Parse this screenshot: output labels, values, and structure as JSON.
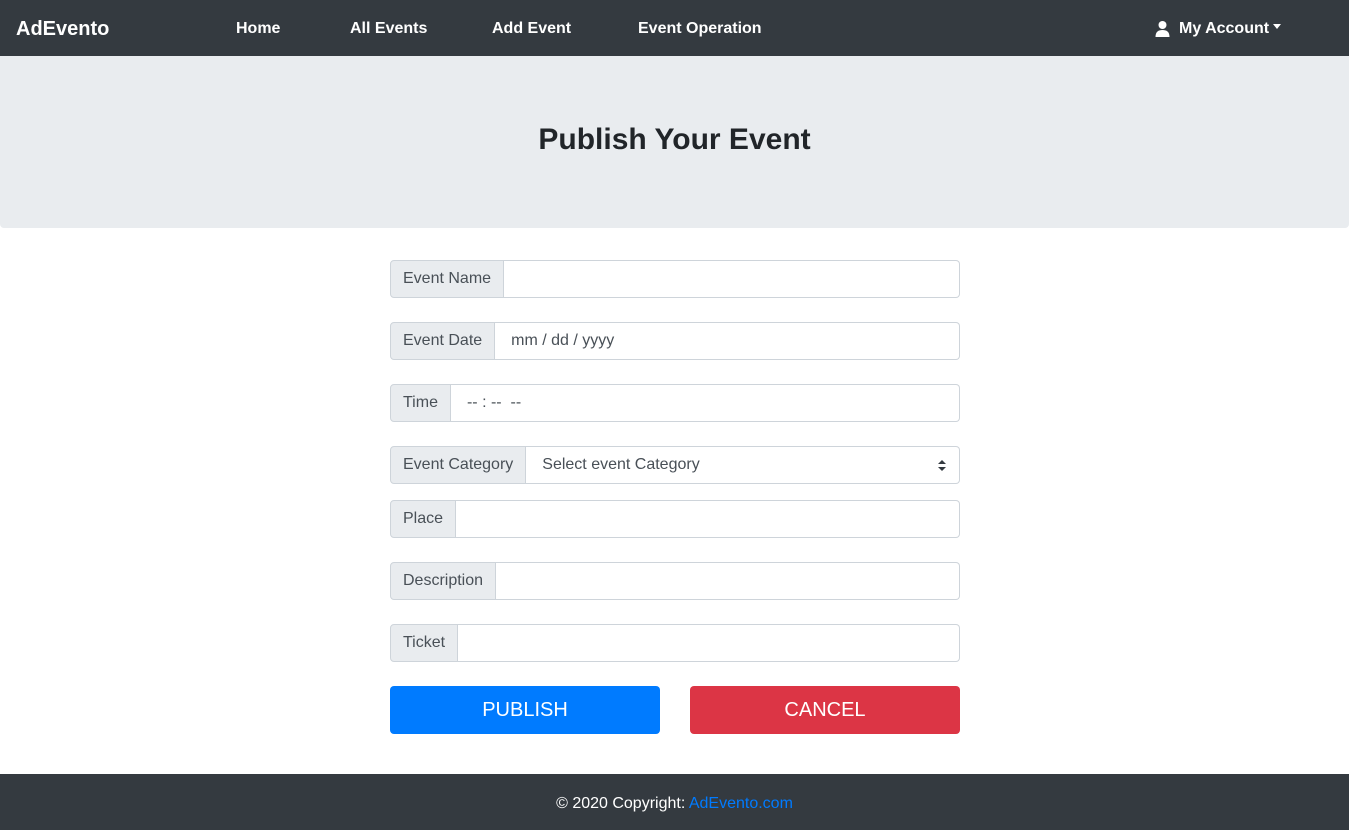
{
  "navbar": {
    "brand": "AdEvento",
    "links": [
      "Home",
      "All Events",
      "Add Event",
      "Event Operation"
    ],
    "account_label": "My Account"
  },
  "header": {
    "title": "Publish Your Event"
  },
  "form": {
    "event_name_label": "Event Name",
    "event_name_value": "",
    "event_date_label": "Event Date",
    "event_date_placeholder": "mm / dd / yyyy",
    "time_label": "Time",
    "time_placeholder": "-- : --  --",
    "category_label": "Event Category",
    "category_selected": "Select event Category",
    "place_label": "Place",
    "place_value": "",
    "description_label": "Description",
    "description_value": "",
    "ticket_label": "Ticket",
    "ticket_value": "",
    "publish_label": "PUBLISH",
    "cancel_label": "CANCEL"
  },
  "footer": {
    "copyright": "© 2020 Copyright: ",
    "link": "AdEvento.com"
  },
  "colors": {
    "navbar": "#343a40",
    "jumbotron": "#e9ecef",
    "primary": "#007bff",
    "danger": "#dc3545"
  }
}
